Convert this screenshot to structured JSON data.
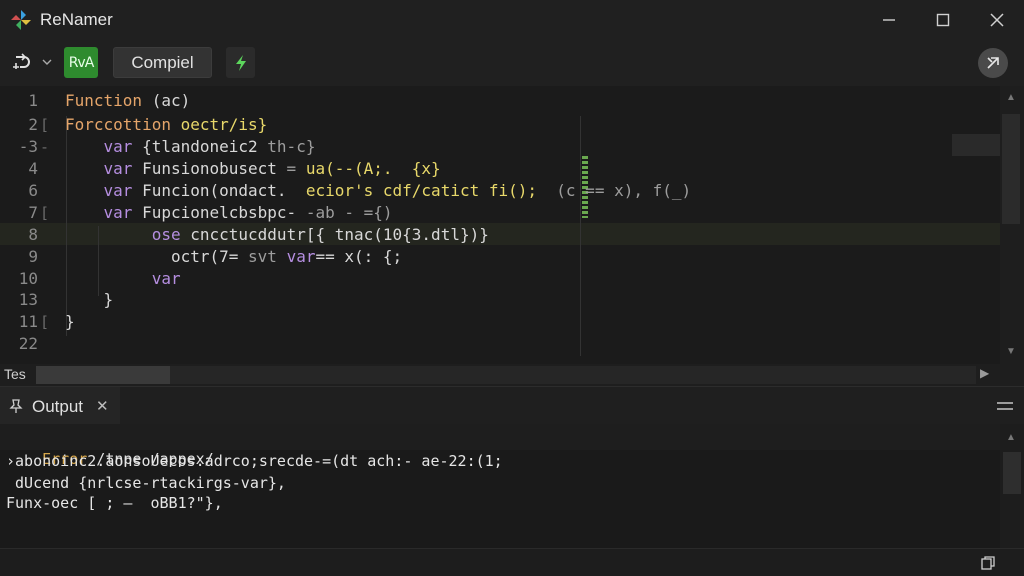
{
  "window": {
    "title": "ReNamer",
    "icons": {
      "logo": "pinwheel-icon",
      "minimize": "minimize-icon",
      "maximize": "maximize-icon",
      "close": "close-icon"
    }
  },
  "toolbar": {
    "refresh_icon": "refresh-icon",
    "dropdown_icon": "chevron-down-icon",
    "run_label": "RvA",
    "compile_label": "Compiel",
    "bolt_icon": "lightning-icon",
    "cancel_icon": "cancel-icon",
    "accent_green": "#2e8b2e"
  },
  "editor": {
    "lines": [
      {
        "num": "1",
        "fold": "",
        "segments": [
          [
            "fn",
            "Function "
          ],
          [
            "plain",
            "(ac)"
          ]
        ]
      },
      {
        "num": "2",
        "fold": "[",
        "segments": [
          [
            "fn",
            "Forccottion "
          ],
          [
            "yellow",
            "oectr/is}"
          ]
        ]
      },
      {
        "num": "-3",
        "fold": "-",
        "segments": [
          [
            "plain",
            "    "
          ],
          [
            "var",
            "var "
          ],
          [
            "plain",
            "{tlandoneic2"
          ],
          [
            "dim",
            " th-c}"
          ]
        ]
      },
      {
        "num": "4",
        "fold": "",
        "segments": [
          [
            "plain",
            "    "
          ],
          [
            "var",
            "var "
          ],
          [
            "plain",
            "Funsionobusect"
          ],
          [
            "dim",
            " = "
          ],
          [
            "yellow",
            "ua(--(A;.  {x}"
          ]
        ]
      },
      {
        "num": "6",
        "fold": "",
        "segments": [
          [
            "plain",
            "    "
          ],
          [
            "var",
            "var "
          ],
          [
            "plain",
            "Funcion(ondact.  "
          ],
          [
            "yellow",
            "ecior's cdf/catict fi();"
          ],
          [
            "dim",
            "  (c == x), f(_)"
          ]
        ]
      },
      {
        "num": "7",
        "fold": "[",
        "segments": [
          [
            "plain",
            "    "
          ],
          [
            "var",
            "var "
          ],
          [
            "plain",
            "Fupcionelcbsbpc-"
          ],
          [
            "dim",
            " -ab - ={)"
          ]
        ]
      },
      {
        "num": "8",
        "fold": "",
        "segments": [
          [
            "plain",
            "         "
          ],
          [
            "var",
            "ose "
          ],
          [
            "plain",
            "cncctucddutr[{ tnac(10{3.dtl})}"
          ]
        ]
      },
      {
        "num": "9",
        "fold": "",
        "segments": [
          [
            "plain",
            "           "
          ],
          [
            "plain",
            "octr(7= "
          ],
          [
            "dim",
            "svt "
          ],
          [
            "var",
            "var"
          ],
          [
            "plain",
            "== x(: {;"
          ]
        ]
      },
      {
        "num": "10",
        "fold": "",
        "segments": [
          [
            "plain",
            "         "
          ],
          [
            "var",
            "var"
          ]
        ]
      },
      {
        "num": "13",
        "fold": "",
        "segments": [
          [
            "plain",
            "    }"
          ]
        ]
      },
      {
        "num": "11",
        "fold": "[",
        "segments": [
          [
            "plain",
            "}"
          ]
        ]
      },
      {
        "num": "22",
        "fold": "",
        "segments": []
      }
    ],
    "colors": {
      "fn": "#e5a56a",
      "var": "#b58ee0",
      "yellow": "#e8d86a"
    }
  },
  "bottom_bar": {
    "label": "Tes"
  },
  "output": {
    "tab_label": "Output",
    "tab_icon": "pin-icon",
    "tab_close_icon": "close-icon",
    "menu_icon": "menu-icon",
    "error_label": "Error",
    "error_path": " /tnpe /appex/",
    "lines": [
      "›abonoinc2.aonsoUecos:adrco;srecde-=(dt ach:- ae-22:(1;",
      " dUcend {nrlcse-rtackirgs-var},",
      "Funx-oec [ ; —  oBB1?\"},"
    ],
    "error_color": "#d6a64a"
  },
  "status": {
    "copy_icon": "copy-icon"
  }
}
